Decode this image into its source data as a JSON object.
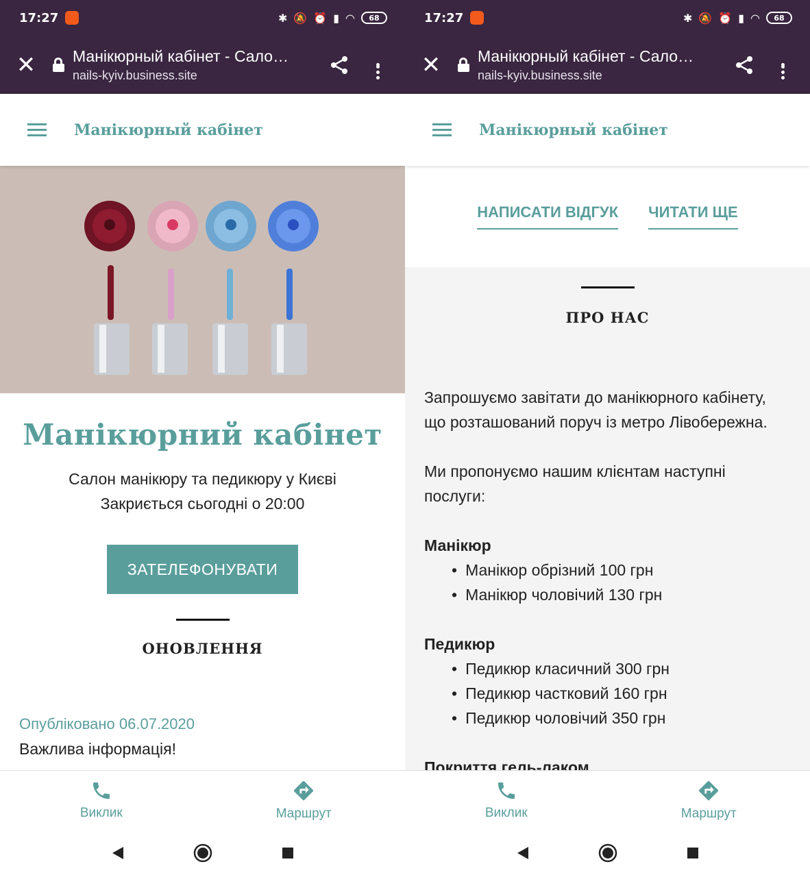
{
  "status_bar": {
    "time": "17:27",
    "battery": "68"
  },
  "browser": {
    "page_title": "Манікюрный кабінет - Сало…",
    "host": "nails-kyiv.business.site",
    "close_icon": "close-icon",
    "share_icon": "share-icon",
    "menu_icon": "more-vert-icon"
  },
  "site": {
    "name": "Манікюрный кабінет",
    "menu_icon": "hamburger-icon"
  },
  "left": {
    "hero_image": "nail-polish-bottles",
    "title": "Манікюрний кабінет",
    "subtitle": "Салон манікюру та педикюру у Києві",
    "hours": "Закриється сьогодні о 20:00",
    "call_button": "ЗАТЕЛЕФОНУВАТИ",
    "updates_heading": "ОНОВЛЕННЯ",
    "post_date": "Опубліковано 06.07.2020",
    "post_text": "Важлива інформація!"
  },
  "right": {
    "write_review": "НАПИСАТИ ВІДГУК",
    "read_more": "ЧИТАТИ ЩЕ",
    "about_heading": "ПРО НАС",
    "intro": "Запрошуємо завітати до манікюрного кабінету, що розташований поруч із метро Лівобережна.",
    "offer": "Ми пропонуємо нашим клієнтам наступні послуги:",
    "categories": [
      {
        "name": "Манікюр",
        "items": [
          "Манікюр обрізний 100 грн",
          "Манікюр чоловічий 130 грн"
        ]
      },
      {
        "name": "Педикюр",
        "items": [
          "Педикюр класичний 300 грн",
          "Педикюр частковий 160 грн",
          "Педикюр чоловічий 350 грн"
        ]
      },
      {
        "name": "Покриття гель-лаком",
        "items": []
      }
    ]
  },
  "actions": {
    "call": "Виклик",
    "route": "Маршрут"
  },
  "colors": {
    "accent": "#5a9e9c",
    "browser_bar": "#3a2640"
  }
}
